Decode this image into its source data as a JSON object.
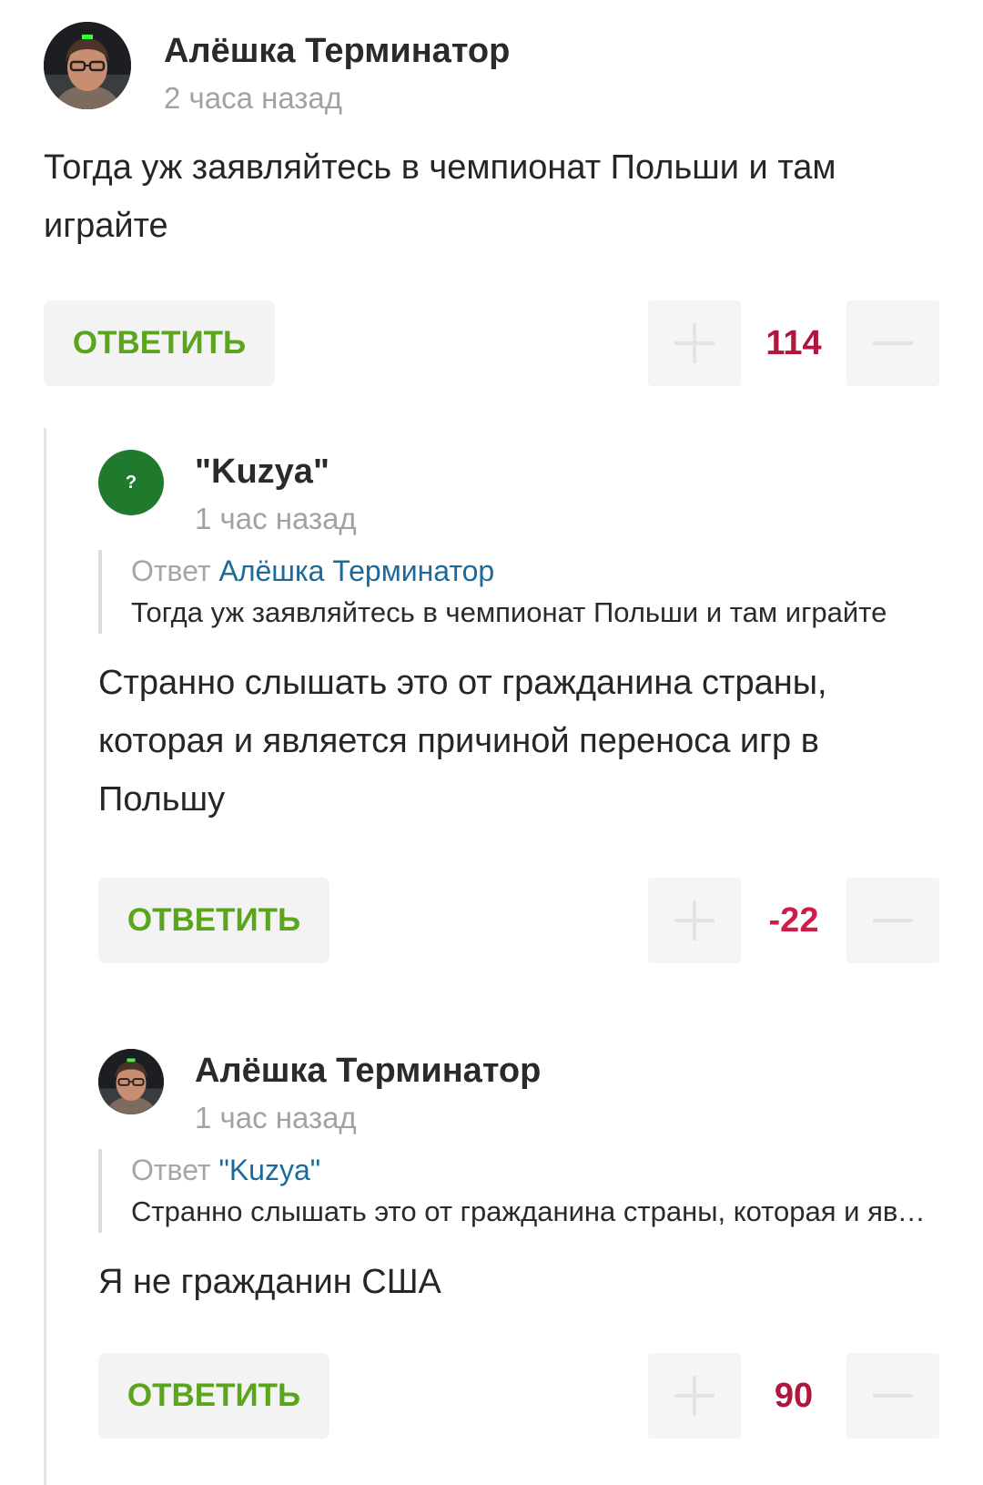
{
  "colors": {
    "reply_text": "#5aa51d",
    "score_positive": "#b0163e",
    "score_negative": "#d01c49",
    "link": "#1b6a9a",
    "muted": "#a2a2a2"
  },
  "comments": [
    {
      "author": "Алёшка Терминатор",
      "avatar": "user-photo",
      "time": "2 часа назад",
      "text": "Тогда уж заявляйтесь в чемпионат Польши и там играйте",
      "reply_label": "ОТВЕТИТЬ",
      "score": "114",
      "score_sign": "positive"
    },
    {
      "author": "\"Kuzya\"",
      "avatar_glyph": "?",
      "time": "1 час назад",
      "quote": {
        "prefix": "Ответ",
        "to": "Алёшка Терминатор",
        "text": "Тогда уж заявляйтесь в чемпионат Польши и там играйте"
      },
      "text": "Странно слышать это от гражданина страны, которая и является причиной переноса игр в Польшу",
      "reply_label": "ОТВЕТИТЬ",
      "score": "-22",
      "score_sign": "negative"
    },
    {
      "author": "Алёшка Терминатор",
      "avatar": "user-photo",
      "time": "1 час назад",
      "quote": {
        "prefix": "Ответ",
        "to": "\"Kuzya\"",
        "text": "Странно слышать это от гражданина страны, которая и является причиной переноса игр в Польшу"
      },
      "text": "Я не гражданин США",
      "reply_label": "ОТВЕТИТЬ",
      "score": "90",
      "score_sign": "positive"
    }
  ]
}
